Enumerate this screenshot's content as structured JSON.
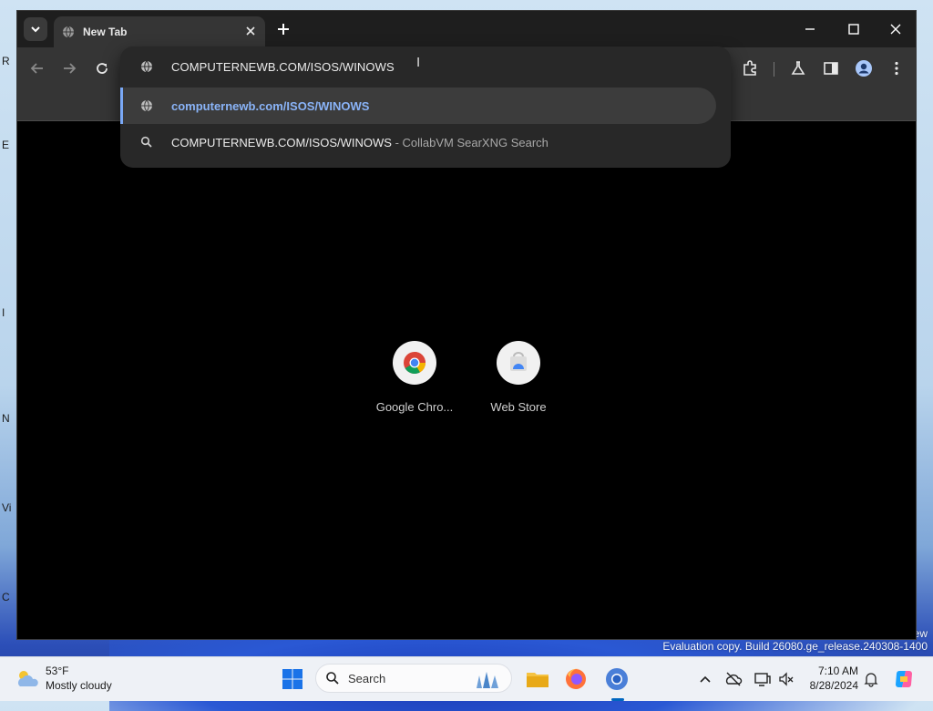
{
  "browser": {
    "tab": {
      "title": "New Tab"
    },
    "omnibox": {
      "input_value": "COMPUTERNEWB.COM/ISOS/WINOWS",
      "suggestions": [
        {
          "icon": "globe-icon",
          "text": "computernewb.com/ISOS/WINOWS"
        },
        {
          "icon": "search-icon",
          "text": "COMPUTERNEWB.COM/ISOS/WINOWS",
          "suffix": " - CollabVM SearXNG Search"
        }
      ]
    },
    "shortcuts": [
      {
        "label": "Google Chro...",
        "icon": "chrome-icon"
      },
      {
        "label": "Web Store",
        "icon": "web-store-icon"
      }
    ]
  },
  "desktop": {
    "edge_labels": [
      "R",
      "E",
      "I",
      "N",
      "Vi",
      "C"
    ],
    "watermark": {
      "line1": "ew",
      "line2": "Evaluation copy. Build 26080.ge_release.240308-1400"
    }
  },
  "taskbar": {
    "weather": {
      "temp": "53°F",
      "condition": "Mostly cloudy"
    },
    "search_label": "Search",
    "clock": {
      "time": "7:10 AM",
      "date": "8/28/2024"
    }
  },
  "colors": {
    "accent": "#8ab4f8",
    "toolbar": "#353535",
    "tabstrip": "#1e1e1e",
    "taskbar_active": "#0067c0"
  }
}
